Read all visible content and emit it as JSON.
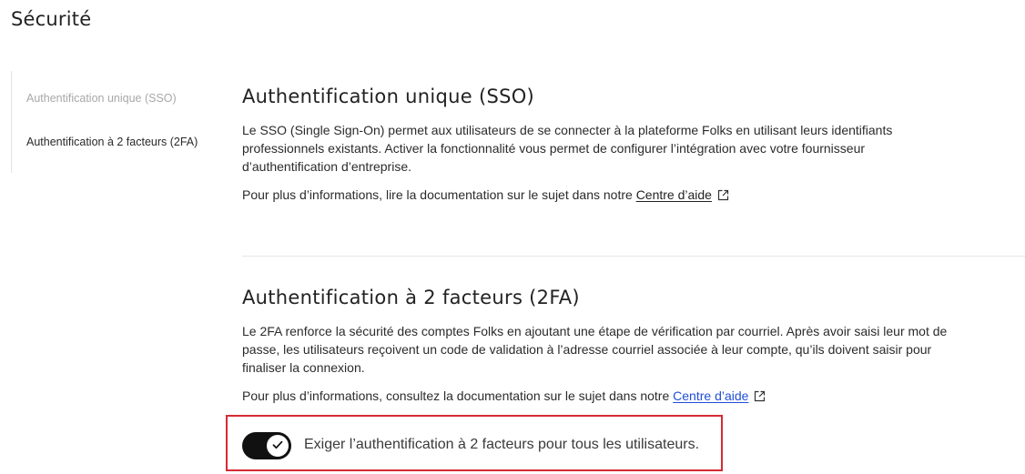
{
  "page": {
    "title": "Sécurité"
  },
  "sidebar": {
    "items": [
      {
        "label": "Authentification unique (SSO)",
        "active": false
      },
      {
        "label": "Authentification à 2 facteurs (2FA)",
        "active": true
      }
    ]
  },
  "sso": {
    "title": "Authentification unique (SSO)",
    "description": "Le SSO (Single Sign-On) permet aux utilisateurs de se connecter à la plateforme Folks en utilisant leurs identifiants professionnels existants. Activer la fonctionnalité vous permet de configurer l’intégration avec votre fournisseur d’authentification d’entreprise.",
    "more_text": "Pour plus d’informations, lire la documentation sur le sujet dans notre",
    "link_label": "Centre d’aide"
  },
  "tfa": {
    "title": "Authentification à 2 facteurs (2FA)",
    "description": "Le 2FA renforce la sécurité des comptes Folks en ajoutant une étape de vérification par courriel. Après avoir saisi leur mot de passe, les utilisateurs reçoivent un code de validation à l’adresse courriel associée à leur compte, qu’ils doivent saisir pour finaliser la connexion.",
    "more_text": "Pour plus d’informations, consultez la documentation sur le sujet dans notre",
    "link_label": "Centre d’aide",
    "toggle": {
      "label": "Exiger l’authentification à 2 facteurs pour tous les utilisateurs.",
      "checked": true
    }
  },
  "colors": {
    "highlight_border": "#d62a33",
    "toggle_on": "#111111",
    "link_blue": "#1f4fd6",
    "sidebar_inactive": "#a8a8a8"
  },
  "icons": {
    "external_link": "external-link-icon",
    "check": "check-icon"
  }
}
